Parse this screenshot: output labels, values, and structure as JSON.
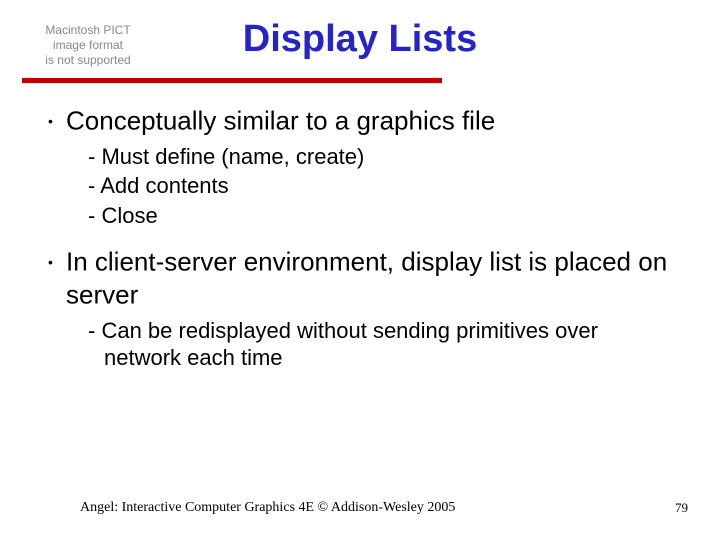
{
  "pict_placeholder": "Macintosh PICT\nimage format\nis not supported",
  "title": "Display Lists",
  "bullets": [
    {
      "text": "Conceptually similar to a graphics file",
      "sub": [
        "Must define (name, create)",
        "Add contents",
        "Close"
      ]
    },
    {
      "text": "In client-server environment, display list is placed on server",
      "sub": [
        "Can be redisplayed without sending primitives over network each time"
      ]
    }
  ],
  "footer": "Angel: Interactive Computer Graphics 4E © Addison-Wesley 2005",
  "page": "79"
}
